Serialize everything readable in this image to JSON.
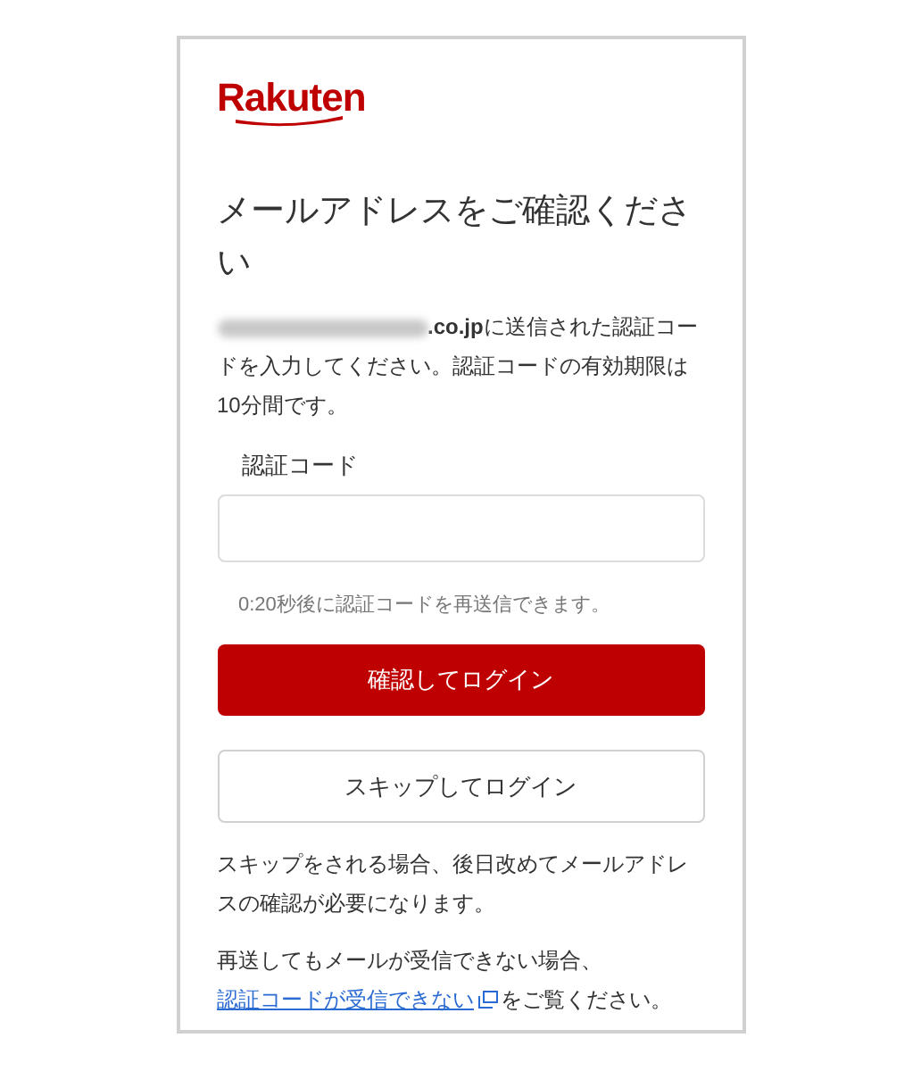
{
  "logo": {
    "text": "Rakuten"
  },
  "heading": "メールアドレスをご確認ください",
  "message": {
    "email_visible": ".co.jp",
    "text": "に送信された認証コードを入力してください。認証コードの有効期限は10分間です。"
  },
  "code_field": {
    "label": "認証コード"
  },
  "resend_hint": "0:20秒後に認証コードを再送信できます。",
  "buttons": [
    {
      "label": "確認してログイン",
      "kind": "primary"
    },
    {
      "label": "スキップしてログイン",
      "kind": "secondary"
    }
  ],
  "skip_note": "スキップをされる場合、後日改めてメールアドレスの確認が必要になります。",
  "help": {
    "before": "再送してもメールが受信できない場合、",
    "link": "認証コードが受信できない",
    "after": "をご覧ください。"
  }
}
